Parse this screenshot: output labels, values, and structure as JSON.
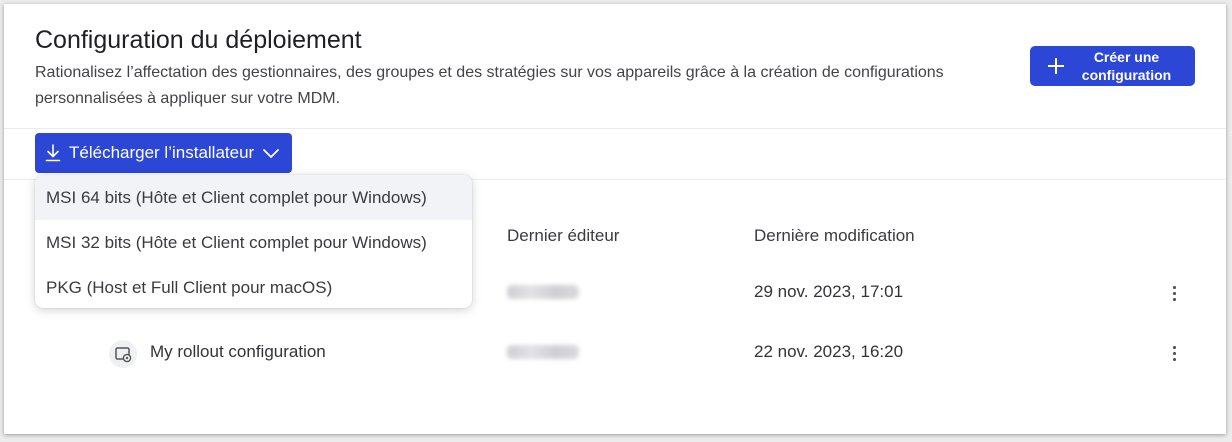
{
  "header": {
    "title": "Configuration du déploiement",
    "description": "Rationalisez l’affectation des gestionnaires, des groupes et des stratégies sur vos appareils grâce à la création de configurations personnalisées à appliquer sur votre MDM.",
    "create_button_line1": "Créer une",
    "create_button_line2": "configuration"
  },
  "toolbar": {
    "download_label": "Télécharger l’installateur"
  },
  "dropdown": {
    "items": [
      "MSI 64 bits (Hôte et Client complet pour Windows)",
      "MSI 32 bits (Hôte et Client complet pour Windows)",
      "PKG (Host et Full Client pour macOS)"
    ]
  },
  "table": {
    "columns": [
      "Dernier éditeur",
      "Dernière modification"
    ],
    "rows": [
      {
        "name": "",
        "last_modified": "29 nov. 2023, 17:01"
      },
      {
        "name": "My rollout configuration",
        "last_modified": "22 nov. 2023, 16:20"
      }
    ]
  },
  "colors": {
    "accent": "#2c47d6",
    "background": "#ffffff"
  },
  "icons": {
    "create": "plus-icon",
    "download": "download-icon",
    "dropdown": "chevron-down-icon",
    "row_menu": "kebab-menu-icon",
    "configuration": "configuration-icon"
  }
}
